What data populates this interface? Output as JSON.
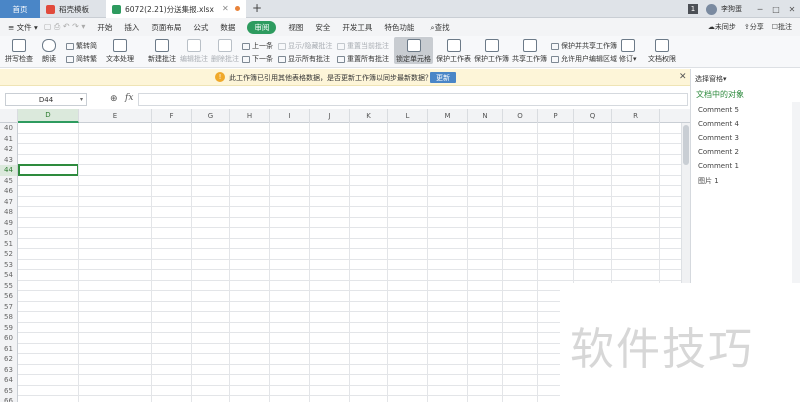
{
  "tabs": {
    "home": "首页",
    "template": "稻壳模板",
    "file": "6072(2.21)分送集报.xlsx",
    "new_tab": "+"
  },
  "titlebar": {
    "badge": "1",
    "user": "李狗蛋",
    "minimize": "─",
    "maximize": "□",
    "close": "✕"
  },
  "menu": {
    "file": "文件",
    "items": [
      "开始",
      "插入",
      "页面布局",
      "公式",
      "数据",
      "审阅",
      "视图",
      "安全",
      "开发工具",
      "特色功能"
    ],
    "active": "审阅",
    "search": "查找",
    "right": [
      "未同步",
      "分享",
      "批注"
    ]
  },
  "ribbon": {
    "spellcheck": "拼写检查",
    "read": "朗读",
    "trad_to_simp": "繁转简",
    "simp_to_trad": "简转繁",
    "text_process": "文本处理",
    "new_comment": "新建批注",
    "edit_comment": "编辑批注",
    "delete_comment": "删除批注",
    "prev": "上一条",
    "next": "下一条",
    "show_hide_comment": "显示/隐藏批注",
    "show_all_comments": "显示所有批注",
    "reset_current_comment": "重置当前批注",
    "reset_all_comments": "重置所有批注",
    "lock_cell": "锁定单元格",
    "protect_sheet": "保护工作表",
    "protect_workbook": "保护工作簿",
    "share_workbook": "共享工作簿",
    "protect_and_share": "保护并共享工作簿",
    "allow_edit_ranges": "允许用户编辑区域",
    "revise": "修订",
    "doc_permission": "文档权限"
  },
  "notice": {
    "icon": "!",
    "text": "此工作簿已引用其他表格数据，是否更新工作簿以同步最新数据？",
    "update": "更新",
    "close": "✕"
  },
  "formula": {
    "cell_ref": "D44",
    "fx": "fx",
    "zoom": "⊕"
  },
  "grid": {
    "columns": [
      "D",
      "E",
      "F",
      "G",
      "H",
      "I",
      "J",
      "K",
      "L",
      "M",
      "N",
      "O",
      "P",
      "Q",
      "R"
    ],
    "selected_column": "D",
    "rows": [
      "40",
      "41",
      "42",
      "43",
      "44",
      "45",
      "46",
      "47",
      "48",
      "49",
      "50",
      "51",
      "52",
      "53",
      "54",
      "55",
      "56",
      "57",
      "58",
      "59",
      "60",
      "61",
      "62",
      "63",
      "64",
      "65",
      "66"
    ],
    "selected_row": "44"
  },
  "pane": {
    "title": "选择窗格",
    "heading": "文档中的对象",
    "items": [
      "Comment 5",
      "Comment 4",
      "Comment 3",
      "Comment 2",
      "Comment 1",
      "图片 1"
    ]
  },
  "watermark": "软件技巧",
  "colors": {
    "accent": "#2e9b5f",
    "tab_home": "#4a86c7",
    "notice_bg": "#fdf5d8"
  }
}
